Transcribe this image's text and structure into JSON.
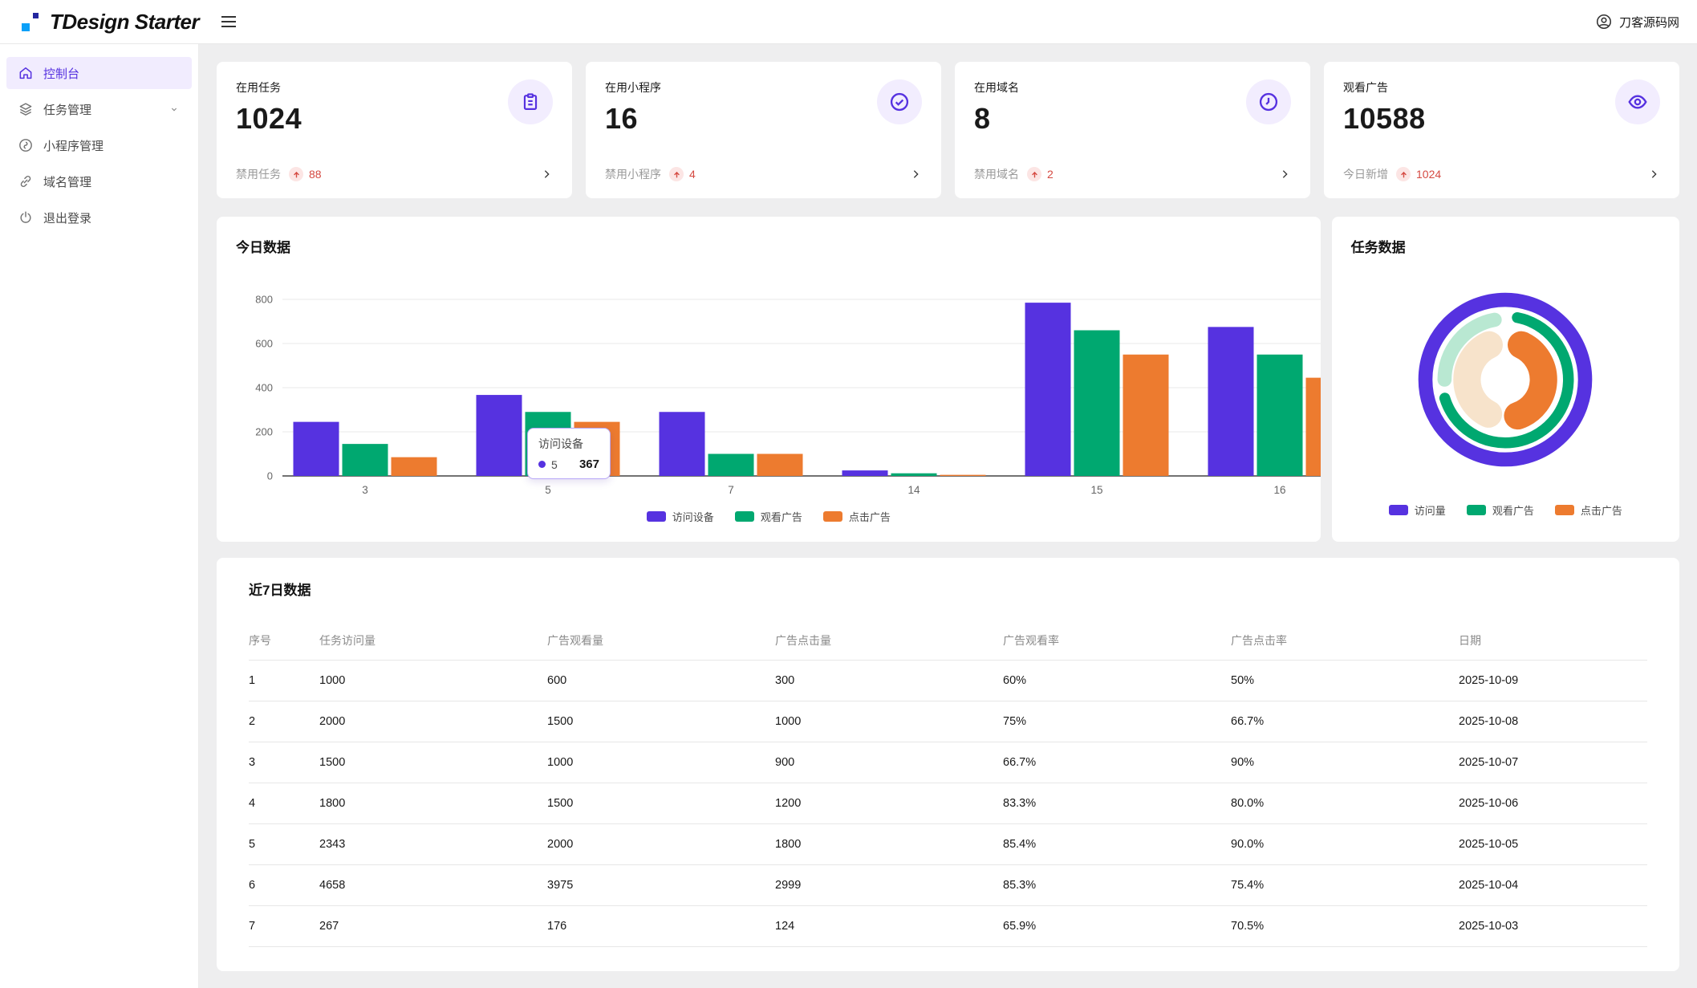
{
  "header": {
    "logo_text": "TDesign Starter",
    "site_name": "刀客源码网"
  },
  "sidebar": {
    "items": [
      {
        "label": "控制台",
        "icon": "home-icon",
        "active": true
      },
      {
        "label": "任务管理",
        "icon": "layers-icon",
        "has_chevron": true
      },
      {
        "label": "小程序管理",
        "icon": "miniprogram-icon"
      },
      {
        "label": "域名管理",
        "icon": "link-icon"
      },
      {
        "label": "退出登录",
        "icon": "power-icon"
      }
    ]
  },
  "stat_cards": [
    {
      "title": "在用任务",
      "value": "1024",
      "icon": "clipboard-icon",
      "footer_label": "禁用任务",
      "footer_value": "88"
    },
    {
      "title": "在用小程序",
      "value": "16",
      "icon": "check-circle-icon",
      "footer_label": "禁用小程序",
      "footer_value": "4"
    },
    {
      "title": "在用域名",
      "value": "8",
      "icon": "clock-icon",
      "footer_label": "禁用域名",
      "footer_value": "2"
    },
    {
      "title": "观看广告",
      "value": "10588",
      "icon": "eye-icon",
      "footer_label": "今日新增",
      "footer_value": "1024"
    }
  ],
  "today_chart": {
    "title": "今日数据",
    "tooltip": {
      "title": "访问设备",
      "series": "5",
      "value": "367"
    }
  },
  "task_chart": {
    "title": "任务数据"
  },
  "table": {
    "title": "近7日数据",
    "columns": [
      "序号",
      "任务访问量",
      "广告观看量",
      "广告点击量",
      "广告观看率",
      "广告点击率",
      "日期"
    ],
    "rows": [
      [
        "1",
        "1000",
        "600",
        "300",
        "60%",
        "50%",
        "2025-10-09"
      ],
      [
        "2",
        "2000",
        "1500",
        "1000",
        "75%",
        "66.7%",
        "2025-10-08"
      ],
      [
        "3",
        "1500",
        "1000",
        "900",
        "66.7%",
        "90%",
        "2025-10-07"
      ],
      [
        "4",
        "1800",
        "1500",
        "1200",
        "83.3%",
        "80.0%",
        "2025-10-06"
      ],
      [
        "5",
        "2343",
        "2000",
        "1800",
        "85.4%",
        "90.0%",
        "2025-10-05"
      ],
      [
        "6",
        "4658",
        "3975",
        "2999",
        "85.3%",
        "75.4%",
        "2025-10-04"
      ],
      [
        "7",
        "267",
        "176",
        "124",
        "65.9%",
        "70.5%",
        "2025-10-03"
      ]
    ]
  },
  "colors": {
    "purple": "#5632e0",
    "green": "#00a870",
    "orange": "#ed7b2f",
    "mint": "#b9e8d2",
    "cream": "#f7e3cb",
    "red": "#d54941"
  },
  "chart_data": [
    {
      "type": "bar",
      "title": "今日数据",
      "categories": [
        "3",
        "5",
        "7",
        "14",
        "15",
        "16"
      ],
      "series": [
        {
          "name": "访问设备",
          "color": "#5632e0",
          "values": [
            245,
            367,
            290,
            25,
            785,
            675
          ]
        },
        {
          "name": "观看广告",
          "color": "#00a870",
          "values": [
            145,
            290,
            100,
            12,
            660,
            550
          ]
        },
        {
          "name": "点击广告",
          "color": "#ed7b2f",
          "values": [
            85,
            245,
            100,
            5,
            550,
            445
          ]
        }
      ],
      "ylim": [
        0,
        800
      ],
      "yticks": [
        0,
        200,
        400,
        600,
        800
      ],
      "grid": true,
      "legend_position": "bottom",
      "tooltip": {
        "category": "5",
        "series": "访问设备",
        "value": 367
      }
    },
    {
      "type": "pie",
      "title": "任务数据",
      "legend": [
        {
          "name": "访问量",
          "color": "#5632e0"
        },
        {
          "name": "观看广告",
          "color": "#00a870"
        },
        {
          "name": "点击广告",
          "color": "#ed7b2f"
        }
      ],
      "rings": [
        {
          "ring": "outer",
          "segments": [
            {
              "label": "访问量",
              "color": "#5632e0",
              "start_deg": 0,
              "end_deg": 360
            }
          ]
        },
        {
          "ring": "middle",
          "segments": [
            {
              "label": "观看广告",
              "color": "#00a870",
              "start_deg": 6,
              "end_deg": 258
            },
            {
              "label": "观看广告-淡",
              "color": "#b9e8d2",
              "start_deg": 263,
              "end_deg": 357
            }
          ]
        },
        {
          "ring": "inner",
          "segments": [
            {
              "label": "点击广告",
              "color": "#ed7b2f",
              "start_deg": 5,
              "end_deg": 182
            },
            {
              "label": "点击广告-淡",
              "color": "#f7e3cb",
              "start_deg": 186,
              "end_deg": 356
            }
          ]
        }
      ],
      "legend_position": "bottom"
    }
  ]
}
